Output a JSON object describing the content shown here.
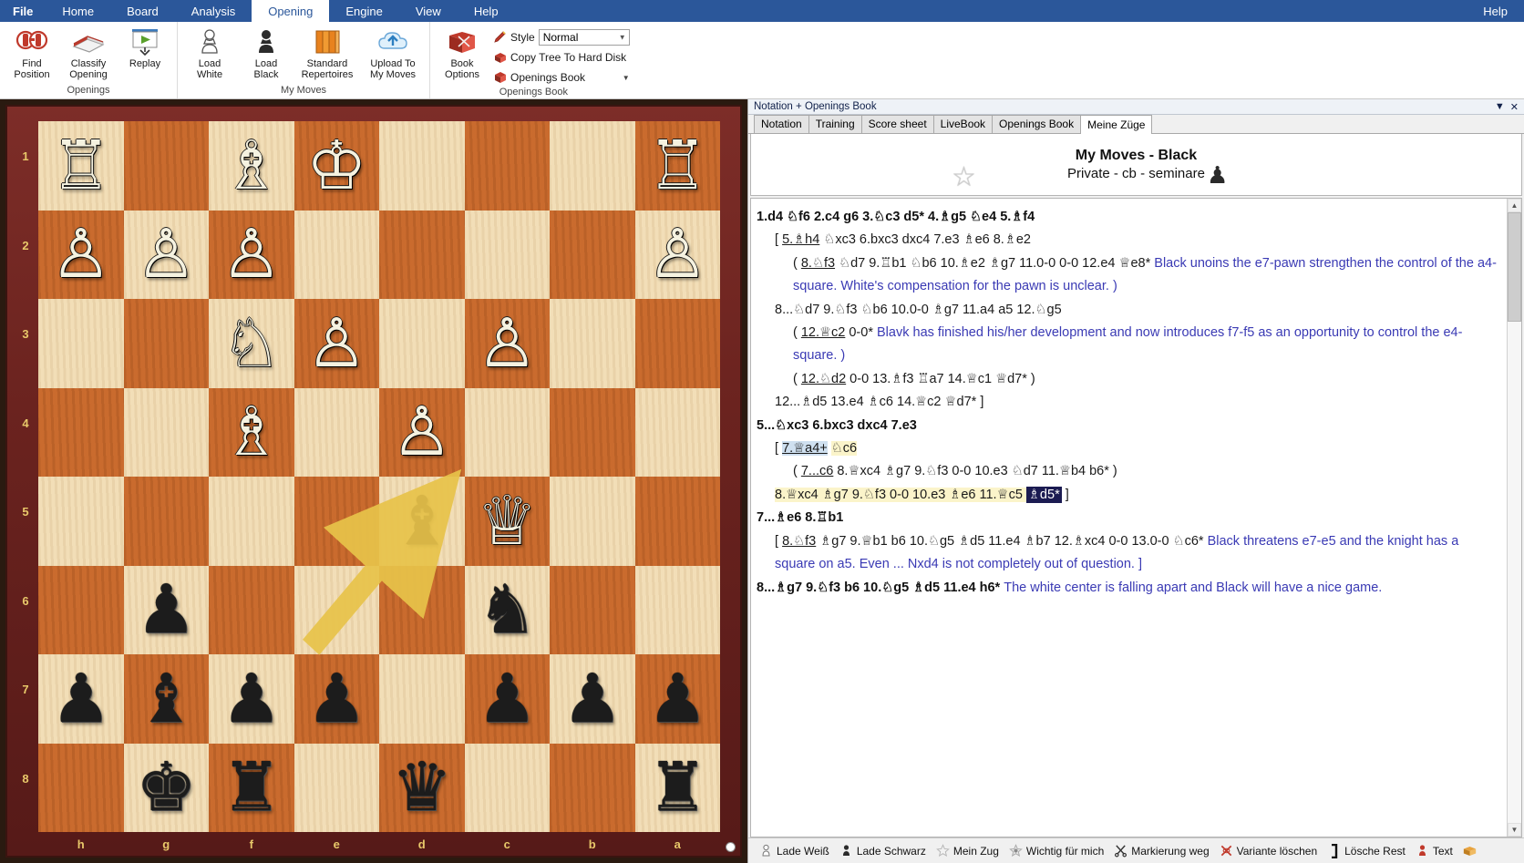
{
  "menubar": {
    "items": [
      {
        "label": "File",
        "active": false,
        "first": true
      },
      {
        "label": "Home",
        "active": false
      },
      {
        "label": "Board",
        "active": false
      },
      {
        "label": "Analysis",
        "active": false
      },
      {
        "label": "Opening",
        "active": true
      },
      {
        "label": "Engine",
        "active": false
      },
      {
        "label": "View",
        "active": false
      },
      {
        "label": "Help",
        "active": false
      }
    ],
    "help_right": "Help"
  },
  "ribbon": {
    "groups": [
      {
        "title": "Openings",
        "buttons": [
          {
            "label_line1": "Find",
            "label_line2": "Position",
            "icon": "find-position-icon"
          },
          {
            "label_line1": "Classify",
            "label_line2": "Opening",
            "icon": "classify-opening-icon"
          },
          {
            "label_line1": "Replay",
            "label_line2": "",
            "icon": "replay-icon"
          }
        ]
      },
      {
        "title": "My Moves",
        "buttons": [
          {
            "label_line1": "Load",
            "label_line2": "White",
            "icon": "white-pawn-icon"
          },
          {
            "label_line1": "Load",
            "label_line2": "Black",
            "icon": "black-pawn-icon"
          },
          {
            "label_line1": "Standard",
            "label_line2": "Repertoires",
            "icon": "books-icon"
          },
          {
            "label_line1": "Upload To",
            "label_line2": "My Moves",
            "icon": "cloud-upload-icon"
          }
        ]
      },
      {
        "title": "Openings Book",
        "buttons": [
          {
            "label_line1": "Book",
            "label_line2": "Options",
            "icon": "book-options-icon"
          }
        ],
        "rows": [
          {
            "label": "Style",
            "icon": "style-icon",
            "combo_value": "Normal",
            "has_combo": true
          },
          {
            "label": "Copy Tree To Hard Disk",
            "icon": "copy-tree-icon",
            "has_combo": false
          },
          {
            "label": "Openings Book",
            "icon": "openings-book-icon",
            "has_combo": false,
            "has_caret": true
          }
        ]
      }
    ]
  },
  "board": {
    "orientation": "black",
    "files": [
      "h",
      "g",
      "f",
      "e",
      "d",
      "c",
      "b",
      "a"
    ],
    "ranks": [
      "1",
      "2",
      "3",
      "4",
      "5",
      "6",
      "7",
      "8"
    ],
    "rows": [
      [
        {
          "p": "R",
          "c": "w"
        },
        {
          "p": "",
          "c": ""
        },
        {
          "p": "B",
          "c": "w"
        },
        {
          "p": "K",
          "c": "w"
        },
        {
          "p": "",
          "c": ""
        },
        {
          "p": "",
          "c": ""
        },
        {
          "p": "",
          "c": ""
        },
        {
          "p": "R",
          "c": "w"
        }
      ],
      [
        {
          "p": "P",
          "c": "w"
        },
        {
          "p": "P",
          "c": "w"
        },
        {
          "p": "P",
          "c": "w"
        },
        {
          "p": "",
          "c": ""
        },
        {
          "p": "",
          "c": ""
        },
        {
          "p": "",
          "c": ""
        },
        {
          "p": "",
          "c": ""
        },
        {
          "p": "P",
          "c": "w"
        }
      ],
      [
        {
          "p": "",
          "c": ""
        },
        {
          "p": "",
          "c": ""
        },
        {
          "p": "N",
          "c": "w"
        },
        {
          "p": "P",
          "c": "w"
        },
        {
          "p": "",
          "c": ""
        },
        {
          "p": "P",
          "c": "w"
        },
        {
          "p": "",
          "c": ""
        },
        {
          "p": "",
          "c": ""
        }
      ],
      [
        {
          "p": "",
          "c": ""
        },
        {
          "p": "",
          "c": ""
        },
        {
          "p": "B",
          "c": "w"
        },
        {
          "p": "",
          "c": ""
        },
        {
          "p": "P",
          "c": "w"
        },
        {
          "p": "",
          "c": ""
        },
        {
          "p": "",
          "c": ""
        },
        {
          "p": "",
          "c": ""
        }
      ],
      [
        {
          "p": "",
          "c": ""
        },
        {
          "p": "",
          "c": ""
        },
        {
          "p": "",
          "c": ""
        },
        {
          "p": "",
          "c": ""
        },
        {
          "p": "B",
          "c": "b"
        },
        {
          "p": "Q",
          "c": "w"
        },
        {
          "p": "",
          "c": ""
        },
        {
          "p": "",
          "c": ""
        }
      ],
      [
        {
          "p": "",
          "c": ""
        },
        {
          "p": "P",
          "c": "b"
        },
        {
          "p": "",
          "c": ""
        },
        {
          "p": "",
          "c": ""
        },
        {
          "p": "",
          "c": ""
        },
        {
          "p": "N",
          "c": "b"
        },
        {
          "p": "",
          "c": ""
        },
        {
          "p": "",
          "c": ""
        }
      ],
      [
        {
          "p": "P",
          "c": "b"
        },
        {
          "p": "B",
          "c": "b"
        },
        {
          "p": "P",
          "c": "b"
        },
        {
          "p": "P",
          "c": "b"
        },
        {
          "p": "",
          "c": ""
        },
        {
          "p": "P",
          "c": "b"
        },
        {
          "p": "P",
          "c": "b"
        },
        {
          "p": "P",
          "c": "b"
        }
      ],
      [
        {
          "p": "",
          "c": ""
        },
        {
          "p": "K",
          "c": "b"
        },
        {
          "p": "R",
          "c": "b"
        },
        {
          "p": "",
          "c": ""
        },
        {
          "p": "Q",
          "c": "b"
        },
        {
          "p": "",
          "c": ""
        },
        {
          "p": "",
          "c": ""
        },
        {
          "p": "R",
          "c": "b"
        }
      ]
    ],
    "arrow": {
      "color": "#e8c34a",
      "from_col": 3,
      "from_row": 5,
      "to_col": 4,
      "to_row": 4
    },
    "turn_indicator": "white"
  },
  "panel": {
    "titlebar": "Notation + Openings Book",
    "tabs": [
      {
        "label": "Notation",
        "selected": false
      },
      {
        "label": "Training",
        "selected": false
      },
      {
        "label": "Score sheet",
        "selected": false
      },
      {
        "label": "LiveBook",
        "selected": false
      },
      {
        "label": "Openings Book",
        "selected": false
      },
      {
        "label": "Meine Züge",
        "selected": true
      }
    ],
    "book_header": {
      "title": "My Moves - Black",
      "subtitle": "Private - cb - seminare",
      "star_icon": "star-icon",
      "pawn_icon": "black-pawn-icon"
    }
  },
  "notation": {
    "lines": [
      {
        "indent": 0,
        "segments": [
          {
            "text": "1.d4 ",
            "style": "mainline"
          },
          {
            "text": "♘f6 2.c4 g6 3.♘c3 d5* 4.♗g5 ♘e4 5.♗f4",
            "style": "mainline"
          }
        ]
      },
      {
        "indent": 1,
        "segments": [
          {
            "text": "[ ",
            "style": "var"
          },
          {
            "text": "5.♗h4",
            "style": "var ulmove"
          },
          {
            "text": " ♘xc3 6.bxc3 dxc4 7.e3 ♗e6 8.♗e2",
            "style": "var"
          }
        ]
      },
      {
        "indent": 2,
        "segments": [
          {
            "text": "( ",
            "style": "var"
          },
          {
            "text": "8.♘f3",
            "style": "var ulmove"
          },
          {
            "text": " ♘d7 9.♖b1 ♘b6 10.♗e2 ♗g7 11.0-0 0-0 12.e4 ♕e8* ",
            "style": "var"
          },
          {
            "text": "Black unoins the e7-pawn strengthen the control of the a4-square. White's compensation for the pawn is unclear. )",
            "style": "cmt"
          }
        ]
      },
      {
        "indent": 1,
        "segments": [
          {
            "text": "8...♘d7 9.♘f3 ♘b6 10.0-0 ♗g7 11.a4 a5 12.♘g5",
            "style": "var"
          }
        ]
      },
      {
        "indent": 2,
        "segments": [
          {
            "text": "( ",
            "style": "var"
          },
          {
            "text": "12.♕c2",
            "style": "var ulmove"
          },
          {
            "text": " 0-0* ",
            "style": "var"
          },
          {
            "text": "Blavk has finished his/her development and now introduces f7-f5 as an opportunity to control the e4-square. )",
            "style": "cmt"
          }
        ]
      },
      {
        "indent": 2,
        "segments": [
          {
            "text": "( ",
            "style": "var"
          },
          {
            "text": "12.♘d2",
            "style": "var ulmove"
          },
          {
            "text": " 0-0 13.♗f3 ♖a7 14.♕c1 ♕d7* )",
            "style": "var"
          }
        ]
      },
      {
        "indent": 1,
        "segments": [
          {
            "text": "12...♗d5 13.e4 ♗c6 14.♕c2 ♕d7* ]",
            "style": "var"
          }
        ]
      },
      {
        "indent": 0,
        "segments": [
          {
            "text": "5...♘xc3 6.bxc3 dxc4 7.e3",
            "style": "mainline"
          }
        ]
      },
      {
        "indent": 1,
        "segments": [
          {
            "text": "[ ",
            "style": "var"
          },
          {
            "text": "7.♕a4+",
            "style": "var ulmove hl-blue"
          },
          {
            "text": " ",
            "style": "var"
          },
          {
            "text": "♘c6",
            "style": "var hl-yellow"
          }
        ]
      },
      {
        "indent": 2,
        "segments": [
          {
            "text": "( ",
            "style": "var"
          },
          {
            "text": "7...c6",
            "style": "var ulmove"
          },
          {
            "text": " 8.♕xc4 ♗g7 9.♘f3 0-0 10.e3 ♘d7 11.♕b4 b6* )",
            "style": "var"
          }
        ]
      },
      {
        "indent": 1,
        "segments": [
          {
            "text": "8.♕xc4 ♗g7 9.♘f3 0-0 10.e3 ♗e6 11.♕c5 ",
            "style": "var hl-yellow"
          },
          {
            "text": "♗d5*",
            "style": "var hl-sel"
          },
          {
            "text": " ]",
            "style": "var"
          }
        ]
      },
      {
        "indent": 0,
        "segments": [
          {
            "text": "7...♗e6 8.♖b1",
            "style": "mainline"
          }
        ]
      },
      {
        "indent": 1,
        "segments": [
          {
            "text": "[ ",
            "style": "var"
          },
          {
            "text": "8.♘f3",
            "style": "var ulmove"
          },
          {
            "text": " ♗g7 9.♕b1 b6 10.♘g5 ♗d5 11.e4 ♗b7 12.♗xc4 0-0 13.0-0 ♘c6* ",
            "style": "var"
          },
          {
            "text": "Black threatens e7-e5 and the knight has a square on a5. Even ... Nxd4 is not completely out of question. ]",
            "style": "cmt"
          }
        ]
      },
      {
        "indent": 0,
        "segments": [
          {
            "text": "8...♗g7 9.♘f3 b6 10.♘g5 ♗d5 11.e4 h6* ",
            "style": "mainline"
          },
          {
            "text": "The white center is falling apart and Black will have a nice game.",
            "style": "cmt"
          }
        ]
      }
    ]
  },
  "bottombar": {
    "buttons": [
      {
        "label": "Lade Weiß",
        "icon": "white-pawn-icon"
      },
      {
        "label": "Lade Schwarz",
        "icon": "black-pawn-icon"
      },
      {
        "label": "Mein Zug",
        "icon": "star-icon"
      },
      {
        "label": "Wichtig für mich",
        "icon": "star-filled-icon"
      },
      {
        "label": "Markierung weg",
        "icon": "scissors-icon"
      },
      {
        "label": "Variante löschen",
        "icon": "red-x-icon"
      },
      {
        "label": "Lösche Rest",
        "icon": "bracket-icon"
      },
      {
        "label": "Text",
        "icon": "red-pawn-icon"
      },
      {
        "label": "",
        "icon": "book-icon"
      }
    ]
  },
  "colors": {
    "menu_blue": "#2b579a",
    "accent_yellow": "#e8c34a",
    "comment_blue": "#3a3ab4",
    "selection_navy": "#1b1b52",
    "board_light": "#f0dcb4",
    "board_dark": "#c86a2c",
    "board_frame": "#6b231f"
  }
}
